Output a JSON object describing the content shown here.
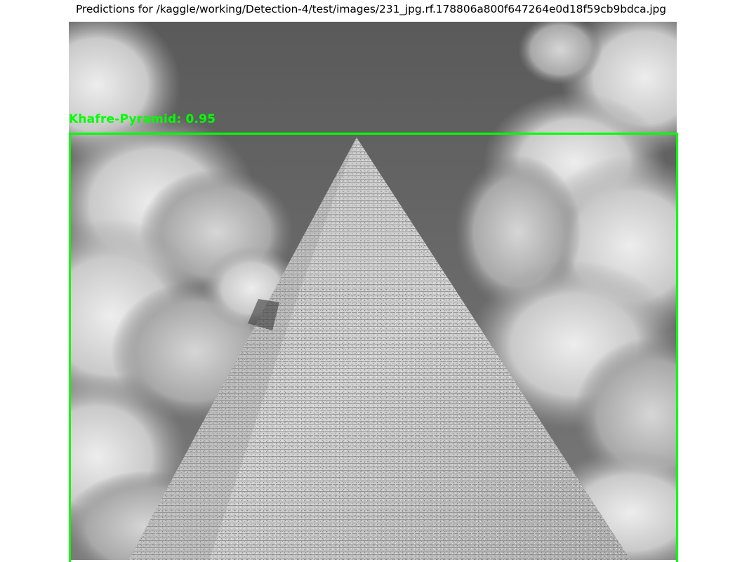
{
  "figure": {
    "title": "Predictions for /kaggle/working/Detection-4/test/images/231_jpg.rf.178806a800f647264e0d18f59cb9bdca.jpg"
  },
  "detection": {
    "label_text": "Khafre-Pyramid: 0.95",
    "box_color": "#00ff00"
  }
}
